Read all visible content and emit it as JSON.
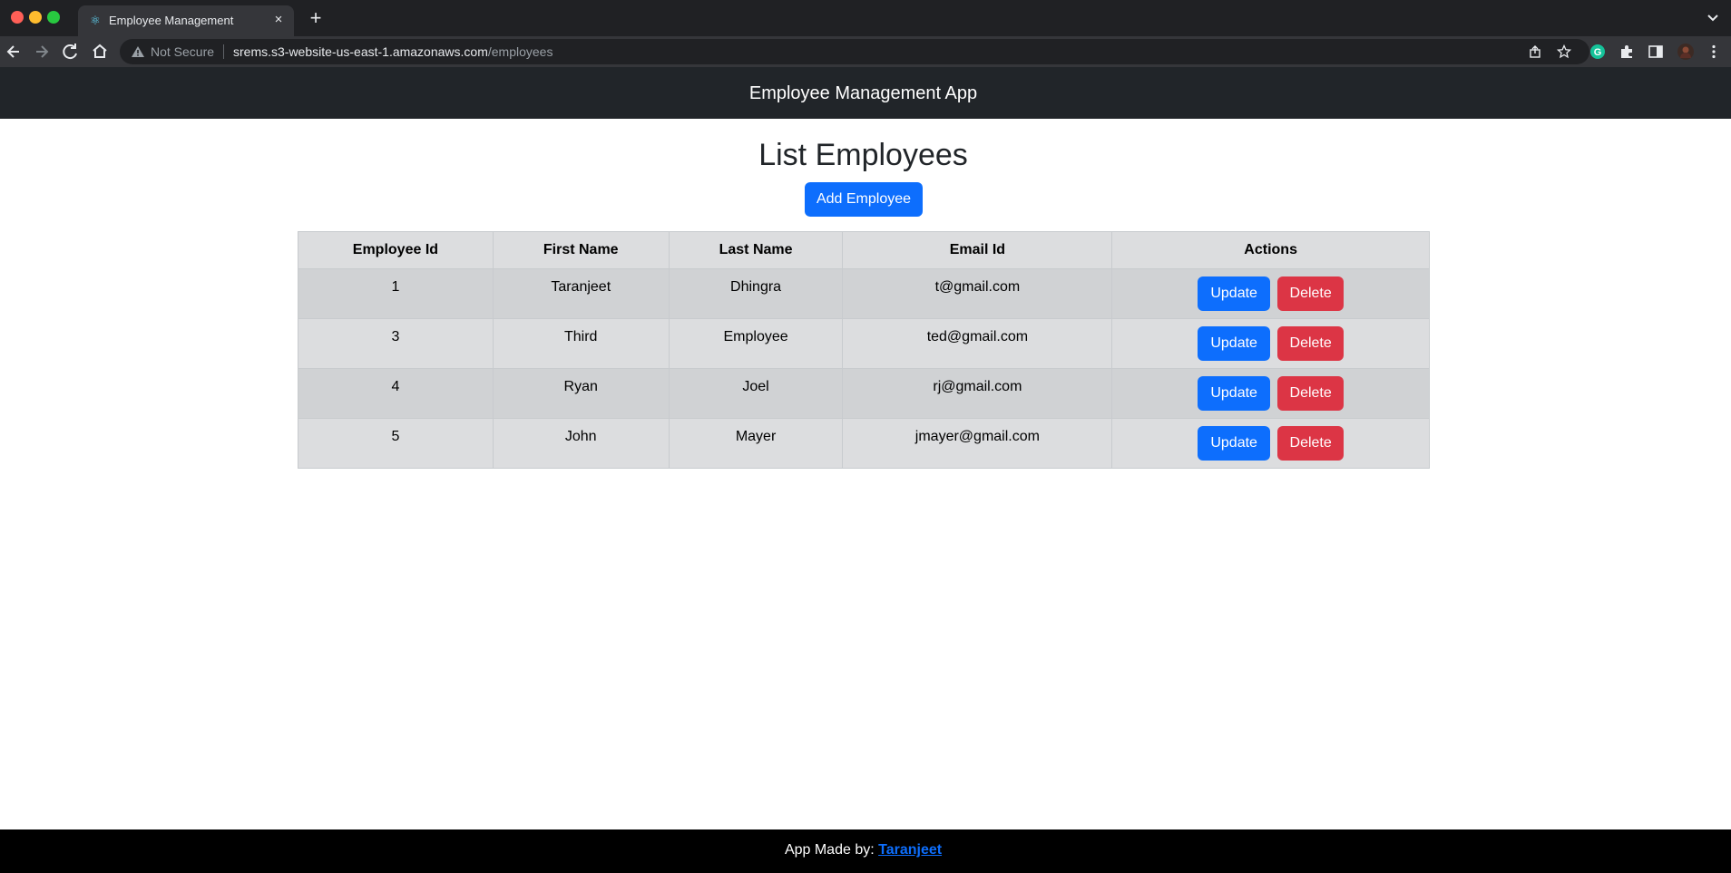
{
  "browser": {
    "tab_title": "Employee Management",
    "tab_close": "×",
    "new_tab": "+",
    "not_secure": "Not Secure",
    "url_host": "srems.s3-website-us-east-1.amazonaws.com",
    "url_path": "/employees",
    "icons": [
      "back-arrow-icon",
      "forward-arrow-icon",
      "reload-icon",
      "home-icon",
      "warning-icon",
      "share-icon",
      "star-icon",
      "grammarly-icon",
      "extensions-icon",
      "side-panel-icon",
      "profile-avatar",
      "kebab-menu-icon"
    ]
  },
  "app": {
    "brand": "Employee Management App",
    "page_title": "List Employees",
    "add_button": "Add Employee",
    "columns": [
      "Employee Id",
      "First Name",
      "Last Name",
      "Email Id",
      "Actions"
    ],
    "rows": [
      {
        "id": "1",
        "first": "Taranjeet",
        "last": "Dhingra",
        "email": "t@gmail.com"
      },
      {
        "id": "3",
        "first": "Third",
        "last": "Employee",
        "email": "ted@gmail.com"
      },
      {
        "id": "4",
        "first": "Ryan",
        "last": "Joel",
        "email": "rj@gmail.com"
      },
      {
        "id": "5",
        "first": "John",
        "last": "Mayer",
        "email": "jmayer@gmail.com"
      }
    ],
    "update_label": "Update",
    "delete_label": "Delete",
    "footer_prefix": "App Made by: ",
    "footer_author": "Taranjeet"
  },
  "colors": {
    "primary": "#0d6efd",
    "danger": "#dc3545",
    "header_bg": "#212529",
    "footer_bg": "#000000"
  }
}
